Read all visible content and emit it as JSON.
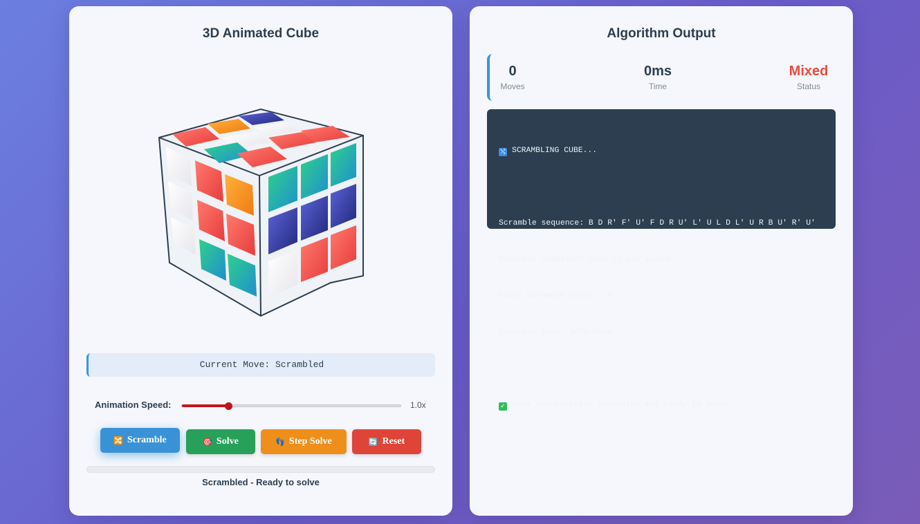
{
  "left_panel": {
    "title": "3D Animated Cube",
    "current_move": "Current Move: Scrambled",
    "speed": {
      "label": "Animation Speed:",
      "value": "1.0x",
      "fraction": 0.2
    },
    "buttons": {
      "scramble": "Scramble",
      "solve": "Solve",
      "step_solve": "Step Solve",
      "reset": "Reset"
    },
    "status": "Scrambled - Ready to solve"
  },
  "right_panel": {
    "title": "Algorithm Output",
    "stats": {
      "moves": {
        "value": "0",
        "label": "Moves"
      },
      "time": {
        "value": "0ms",
        "label": "Time"
      },
      "status": {
        "value": "Mixed",
        "label": "Status"
      }
    },
    "console": {
      "header": "SCRAMBLING CUBE...",
      "sequence": "Scramble sequence: B D R' F' U' F D R U' L' U L D L' U R B U' R' U'",
      "complete": "Scramble complete! Cube is now mixed.",
      "total": "Total scramble moves: 20",
      "time": "Scramble time: 3078.00ms",
      "success": "Cube successfully scrambled and ready to solve!"
    }
  },
  "colors": {
    "accent": "#3498db",
    "scramble": "#3a92d6",
    "solve": "#27a05a",
    "step": "#ee8f1c",
    "reset": "#de4437",
    "mixed": "#e74c3c"
  }
}
